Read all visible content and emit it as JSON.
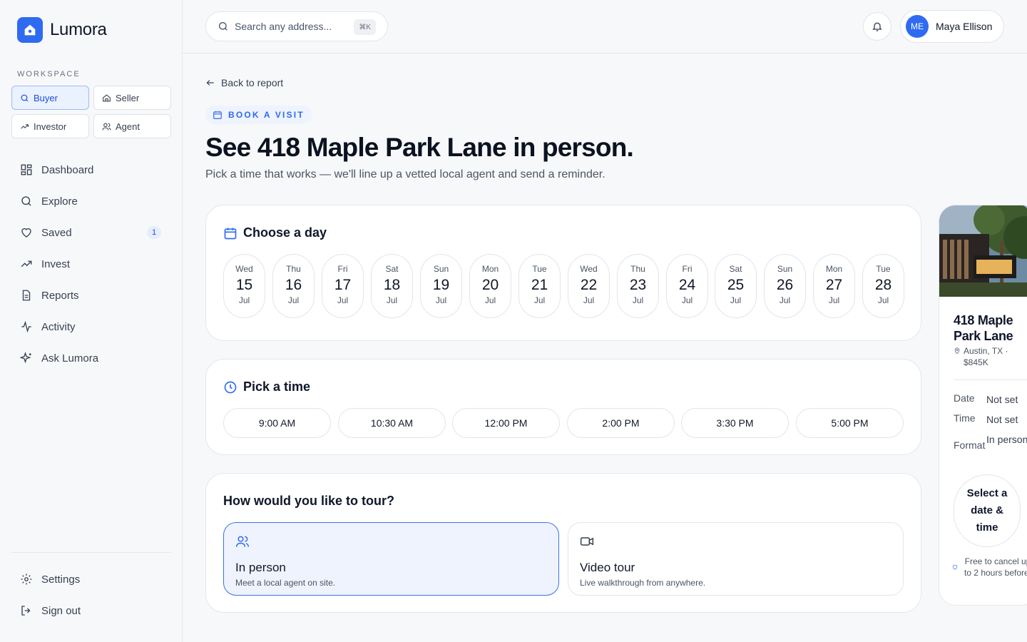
{
  "brand": {
    "name": "Lumora",
    "accent": "#2f6bf0"
  },
  "sidebar": {
    "section_label": "WORKSPACE",
    "personas": [
      {
        "label": "Buyer",
        "icon": "search-icon",
        "active": true
      },
      {
        "label": "Seller",
        "icon": "home-icon"
      },
      {
        "label": "Investor",
        "icon": "trending-up-icon"
      },
      {
        "label": "Agent",
        "icon": "users-icon"
      }
    ],
    "nav": [
      {
        "label": "Dashboard",
        "icon": "grid-icon"
      },
      {
        "label": "Explore",
        "icon": "search-icon"
      },
      {
        "label": "Saved",
        "icon": "heart-icon",
        "badge": "1"
      },
      {
        "label": "Invest",
        "icon": "trending-up-icon"
      },
      {
        "label": "Reports",
        "icon": "document-icon"
      },
      {
        "label": "Activity",
        "icon": "activity-icon"
      },
      {
        "label": "Ask Lumora",
        "icon": "sparkles-icon"
      }
    ],
    "footer": [
      {
        "label": "Settings",
        "icon": "gear-icon"
      },
      {
        "label": "Sign out",
        "icon": "logout-icon"
      }
    ]
  },
  "header": {
    "search_placeholder": "Search any address...",
    "search_shortcut": "⌘K",
    "user": {
      "name": "Maya Ellison",
      "initials": "ME"
    }
  },
  "main": {
    "back_label": "Back to report",
    "eyebrow": "BOOK A VISIT",
    "title": "See 418 Maple Park Lane in person.",
    "subtitle": "Pick a time that works — we'll line up a vetted local agent and send a reminder.",
    "day_section": {
      "title": "Choose a day",
      "days": [
        {
          "dow": "Wed",
          "num": "15",
          "mon": "Jul"
        },
        {
          "dow": "Thu",
          "num": "16",
          "mon": "Jul"
        },
        {
          "dow": "Fri",
          "num": "17",
          "mon": "Jul"
        },
        {
          "dow": "Sat",
          "num": "18",
          "mon": "Jul"
        },
        {
          "dow": "Sun",
          "num": "19",
          "mon": "Jul"
        },
        {
          "dow": "Mon",
          "num": "20",
          "mon": "Jul"
        },
        {
          "dow": "Tue",
          "num": "21",
          "mon": "Jul"
        },
        {
          "dow": "Wed",
          "num": "22",
          "mon": "Jul"
        },
        {
          "dow": "Thu",
          "num": "23",
          "mon": "Jul"
        },
        {
          "dow": "Fri",
          "num": "24",
          "mon": "Jul"
        },
        {
          "dow": "Sat",
          "num": "25",
          "mon": "Jul"
        },
        {
          "dow": "Sun",
          "num": "26",
          "mon": "Jul"
        },
        {
          "dow": "Mon",
          "num": "27",
          "mon": "Jul"
        },
        {
          "dow": "Tue",
          "num": "28",
          "mon": "Jul"
        }
      ]
    },
    "time_section": {
      "title": "Pick a time",
      "times": [
        "9:00 AM",
        "10:30 AM",
        "12:00 PM",
        "2:00 PM",
        "3:30 PM",
        "5:00 PM"
      ]
    },
    "format_section": {
      "title": "How would you like to tour?",
      "options": [
        {
          "title": "In person",
          "desc": "Meet a local agent on site.",
          "icon": "users-icon",
          "selected": true
        },
        {
          "title": "Video tour",
          "desc": "Live walkthrough from anywhere.",
          "icon": "video-icon",
          "selected": false
        }
      ]
    }
  },
  "summary": {
    "title": "418 Maple Park Lane",
    "location": "Austin, TX · $845K",
    "rows": [
      {
        "key": "Date",
        "value": "Not set"
      },
      {
        "key": "Time",
        "value": "Not set"
      },
      {
        "key": "Format",
        "value": "In person"
      }
    ],
    "cta": "Select a date & time",
    "fine_print": "Free to cancel up to 2 hours before."
  }
}
